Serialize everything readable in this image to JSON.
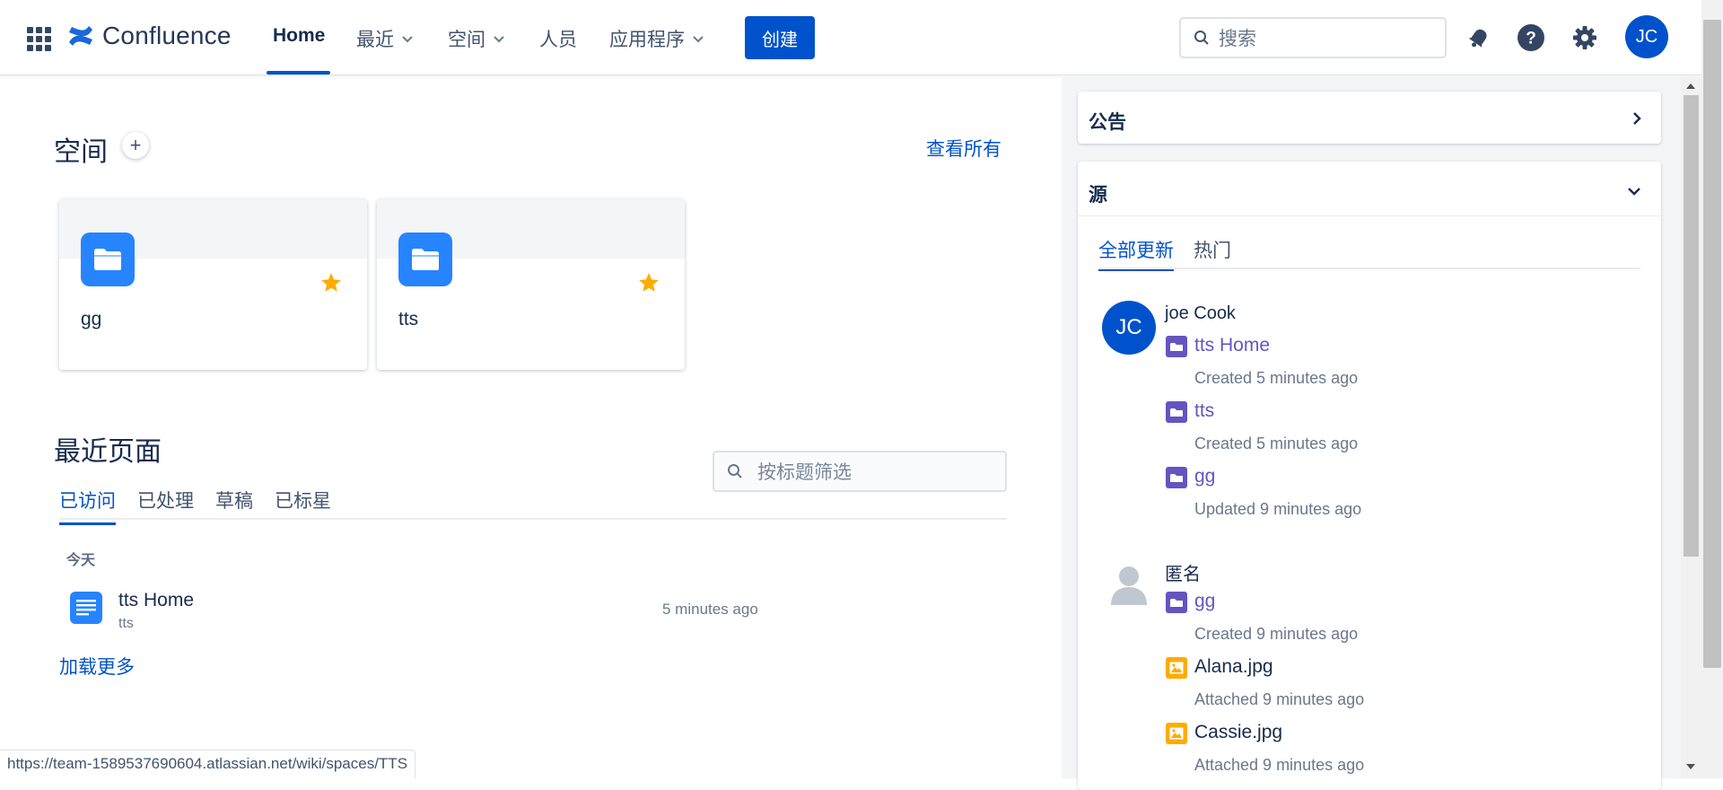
{
  "nav": {
    "product": "Confluence",
    "items": [
      {
        "label": "Home",
        "active": true
      },
      {
        "label": "最近",
        "dropdown": true
      },
      {
        "label": "空间",
        "dropdown": true
      },
      {
        "label": "人员"
      },
      {
        "label": "应用程序",
        "dropdown": true
      }
    ],
    "create_label": "创建",
    "search_placeholder": "搜索",
    "avatar_initials": "JC"
  },
  "spaces": {
    "heading": "空间",
    "see_all": "查看所有",
    "cards": [
      {
        "name": "gg",
        "starred": true
      },
      {
        "name": "tts",
        "starred": true
      }
    ]
  },
  "recent": {
    "heading": "最近页面",
    "filter_placeholder": "按标题筛选",
    "tabs": [
      "已访问",
      "已处理",
      "草稿",
      "已标星"
    ],
    "active_tab": "已访问",
    "group_label": "今天",
    "items": [
      {
        "title": "tts Home",
        "space": "tts",
        "time": "5 minutes ago"
      }
    ],
    "load_more": "加载更多"
  },
  "status_url": "https://team-1589537690604.atlassian.net/wiki/spaces/TTS",
  "side": {
    "announcements_title": "公告",
    "feed_title": "源",
    "feed_tabs": [
      "全部更新",
      "热门"
    ],
    "active_feed_tab": "全部更新",
    "feed": [
      {
        "user": "joe Cook",
        "initials": "JC",
        "entries": [
          {
            "title": "tts Home",
            "meta": "Created 5 minutes ago",
            "kind": "space"
          },
          {
            "title": "tts",
            "meta": "Created 5 minutes ago",
            "kind": "space"
          },
          {
            "title": "gg",
            "meta": "Updated 9 minutes ago",
            "kind": "space"
          }
        ]
      },
      {
        "user": "匿名",
        "initials": "",
        "entries": [
          {
            "title": "gg",
            "meta": "Created 9 minutes ago",
            "kind": "space"
          },
          {
            "title": "Alana.jpg",
            "meta": "Attached 9 minutes ago",
            "kind": "image"
          },
          {
            "title": "Cassie.jpg",
            "meta": "Attached 9 minutes ago",
            "kind": "image"
          }
        ]
      }
    ]
  },
  "colors": {
    "brand": "#0052cc",
    "space_icon": "#2684ff",
    "star": "#ffab00",
    "feed_link": "#6554c0",
    "image_icon": "#ffab00"
  }
}
